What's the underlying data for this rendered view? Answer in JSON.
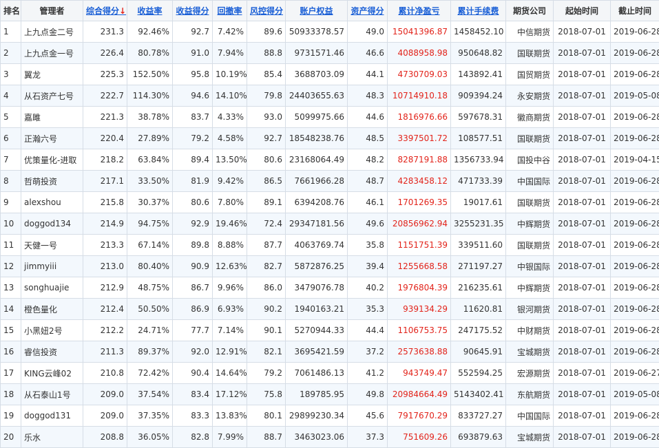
{
  "headers": {
    "rank": "排名",
    "manager": "管理者",
    "total_score": "综合得分",
    "total_score_arrow": "↓",
    "return_rate": "收益率",
    "return_score": "收益得分",
    "drawdown": "回撤率",
    "risk_score": "风控得分",
    "equity": "账户权益",
    "asset_score": "资产得分",
    "net_profit": "累计净盈亏",
    "fees": "累计手续费",
    "broker": "期货公司",
    "start": "起始时间",
    "end": "截止时间"
  },
  "colors": {
    "link": "#1a5fd6",
    "profit": "#e2231a",
    "stripe": "#f3f8fd"
  },
  "rows": [
    {
      "rank": "1",
      "manager": "上九点金二号",
      "total_score": "231.3",
      "return_rate": "92.46%",
      "return_score": "92.7",
      "drawdown": "7.42%",
      "risk_score": "89.6",
      "equity": "50933378.57",
      "asset_score": "49.0",
      "net_profit": "15041396.87",
      "fees": "1458452.10",
      "broker": "中信期货",
      "start": "2018-07-01",
      "end": "2019-06-28"
    },
    {
      "rank": "2",
      "manager": "上九点金一号",
      "total_score": "226.4",
      "return_rate": "80.78%",
      "return_score": "91.0",
      "drawdown": "7.94%",
      "risk_score": "88.8",
      "equity": "9731571.46",
      "asset_score": "46.6",
      "net_profit": "4088958.98",
      "fees": "950648.82",
      "broker": "国联期货",
      "start": "2018-07-01",
      "end": "2019-06-28"
    },
    {
      "rank": "3",
      "manager": "翼龙",
      "total_score": "225.3",
      "return_rate": "152.50%",
      "return_score": "95.8",
      "drawdown": "10.19%",
      "risk_score": "85.4",
      "equity": "3688703.09",
      "asset_score": "44.1",
      "net_profit": "4730709.03",
      "fees": "143892.41",
      "broker": "国贸期货",
      "start": "2018-07-01",
      "end": "2019-06-28"
    },
    {
      "rank": "4",
      "manager": "从石资产七号",
      "total_score": "222.7",
      "return_rate": "114.30%",
      "return_score": "94.6",
      "drawdown": "14.10%",
      "risk_score": "79.8",
      "equity": "24403655.63",
      "asset_score": "48.3",
      "net_profit": "10714910.18",
      "fees": "909394.24",
      "broker": "永安期货",
      "start": "2018-07-01",
      "end": "2019-05-08"
    },
    {
      "rank": "5",
      "manager": "嘉雎",
      "total_score": "221.3",
      "return_rate": "38.78%",
      "return_score": "83.7",
      "drawdown": "4.33%",
      "risk_score": "93.0",
      "equity": "5099975.66",
      "asset_score": "44.6",
      "net_profit": "1816976.66",
      "fees": "597678.31",
      "broker": "徽商期货",
      "start": "2018-07-01",
      "end": "2019-06-28"
    },
    {
      "rank": "6",
      "manager": "正瀚六号",
      "total_score": "220.4",
      "return_rate": "27.89%",
      "return_score": "79.2",
      "drawdown": "4.58%",
      "risk_score": "92.7",
      "equity": "18548238.76",
      "asset_score": "48.5",
      "net_profit": "3397501.72",
      "fees": "108577.51",
      "broker": "国联期货",
      "start": "2018-07-01",
      "end": "2019-06-28"
    },
    {
      "rank": "7",
      "manager": "优策量化-进取",
      "total_score": "218.2",
      "return_rate": "63.84%",
      "return_score": "89.4",
      "drawdown": "13.50%",
      "risk_score": "80.6",
      "equity": "23168064.49",
      "asset_score": "48.2",
      "net_profit": "8287191.88",
      "fees": "1356733.94",
      "broker": "国投中谷",
      "start": "2018-07-01",
      "end": "2019-04-15"
    },
    {
      "rank": "8",
      "manager": "哲萌投资",
      "total_score": "217.1",
      "return_rate": "33.50%",
      "return_score": "81.9",
      "drawdown": "9.42%",
      "risk_score": "86.5",
      "equity": "7661966.28",
      "asset_score": "48.7",
      "net_profit": "4283458.12",
      "fees": "471733.39",
      "broker": "中国国际",
      "start": "2018-07-01",
      "end": "2019-06-28"
    },
    {
      "rank": "9",
      "manager": "alexshou",
      "total_score": "215.8",
      "return_rate": "30.37%",
      "return_score": "80.6",
      "drawdown": "7.80%",
      "risk_score": "89.1",
      "equity": "6394208.76",
      "asset_score": "46.1",
      "net_profit": "1701269.35",
      "fees": "19017.61",
      "broker": "国联期货",
      "start": "2018-07-01",
      "end": "2019-06-28"
    },
    {
      "rank": "10",
      "manager": "doggod134",
      "total_score": "214.9",
      "return_rate": "94.75%",
      "return_score": "92.9",
      "drawdown": "19.46%",
      "risk_score": "72.4",
      "equity": "29347181.56",
      "asset_score": "49.6",
      "net_profit": "20856962.94",
      "fees": "3255231.35",
      "broker": "中辉期货",
      "start": "2018-07-01",
      "end": "2019-06-28"
    },
    {
      "rank": "11",
      "manager": "天健一号",
      "total_score": "213.3",
      "return_rate": "67.14%",
      "return_score": "89.8",
      "drawdown": "8.88%",
      "risk_score": "87.7",
      "equity": "4063769.74",
      "asset_score": "35.8",
      "net_profit": "1151751.39",
      "fees": "339511.60",
      "broker": "国联期货",
      "start": "2018-07-01",
      "end": "2019-06-28"
    },
    {
      "rank": "12",
      "manager": "jimmyiii",
      "total_score": "213.0",
      "return_rate": "80.40%",
      "return_score": "90.9",
      "drawdown": "12.63%",
      "risk_score": "82.7",
      "equity": "5872876.25",
      "asset_score": "39.4",
      "net_profit": "1255668.58",
      "fees": "271197.27",
      "broker": "中银国际",
      "start": "2018-07-01",
      "end": "2019-06-28"
    },
    {
      "rank": "13",
      "manager": "songhuajie",
      "total_score": "212.9",
      "return_rate": "48.75%",
      "return_score": "86.7",
      "drawdown": "9.96%",
      "risk_score": "86.0",
      "equity": "3479076.78",
      "asset_score": "40.2",
      "net_profit": "1976804.39",
      "fees": "216235.61",
      "broker": "中辉期货",
      "start": "2018-07-01",
      "end": "2019-06-28"
    },
    {
      "rank": "14",
      "manager": "橙色量化",
      "total_score": "212.4",
      "return_rate": "50.50%",
      "return_score": "86.9",
      "drawdown": "6.93%",
      "risk_score": "90.2",
      "equity": "1940163.21",
      "asset_score": "35.3",
      "net_profit": "939134.29",
      "fees": "11620.81",
      "broker": "银河期货",
      "start": "2018-07-01",
      "end": "2019-06-28"
    },
    {
      "rank": "15",
      "manager": "小黑妞2号",
      "total_score": "212.2",
      "return_rate": "24.71%",
      "return_score": "77.7",
      "drawdown": "7.14%",
      "risk_score": "90.1",
      "equity": "5270944.33",
      "asset_score": "44.4",
      "net_profit": "1106753.75",
      "fees": "247175.52",
      "broker": "中财期货",
      "start": "2018-07-01",
      "end": "2019-06-28"
    },
    {
      "rank": "16",
      "manager": "睿信投资",
      "total_score": "211.3",
      "return_rate": "89.37%",
      "return_score": "92.0",
      "drawdown": "12.91%",
      "risk_score": "82.1",
      "equity": "3695421.59",
      "asset_score": "37.2",
      "net_profit": "2573638.88",
      "fees": "90645.91",
      "broker": "宝城期货",
      "start": "2018-07-01",
      "end": "2019-06-28"
    },
    {
      "rank": "17",
      "manager": "KING云峰02",
      "total_score": "210.8",
      "return_rate": "72.42%",
      "return_score": "90.4",
      "drawdown": "14.64%",
      "risk_score": "79.2",
      "equity": "7061486.13",
      "asset_score": "41.2",
      "net_profit": "943749.47",
      "fees": "552594.25",
      "broker": "宏源期货",
      "start": "2018-07-01",
      "end": "2019-06-27"
    },
    {
      "rank": "18",
      "manager": "从石泰山1号",
      "total_score": "209.0",
      "return_rate": "37.54%",
      "return_score": "83.4",
      "drawdown": "17.12%",
      "risk_score": "75.8",
      "equity": "189785.95",
      "asset_score": "49.8",
      "net_profit": "20984664.49",
      "fees": "5143402.41",
      "broker": "东航期货",
      "start": "2018-07-01",
      "end": "2019-05-08"
    },
    {
      "rank": "19",
      "manager": "doggod131",
      "total_score": "209.0",
      "return_rate": "37.35%",
      "return_score": "83.3",
      "drawdown": "13.83%",
      "risk_score": "80.1",
      "equity": "29899230.34",
      "asset_score": "45.6",
      "net_profit": "7917670.29",
      "fees": "833727.27",
      "broker": "中国国际",
      "start": "2018-07-01",
      "end": "2019-06-28"
    },
    {
      "rank": "20",
      "manager": "乐水",
      "total_score": "208.8",
      "return_rate": "36.05%",
      "return_score": "82.8",
      "drawdown": "7.99%",
      "risk_score": "88.7",
      "equity": "3463023.06",
      "asset_score": "37.3",
      "net_profit": "751609.26",
      "fees": "693879.63",
      "broker": "宝城期货",
      "start": "2018-07-01",
      "end": "2019-06-28"
    }
  ]
}
